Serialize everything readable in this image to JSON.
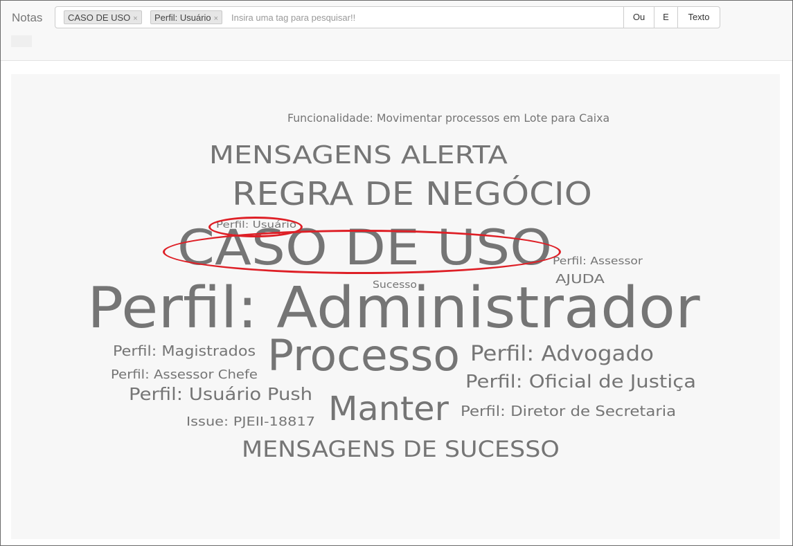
{
  "header": {
    "title": "Notas",
    "search": {
      "tags": [
        {
          "label": "CASO DE USO",
          "remove": "×"
        },
        {
          "label": "Perfil: Usuário",
          "remove": "×"
        }
      ],
      "placeholder": "Insira uma tag para pesquisar!!",
      "value": ""
    },
    "buttons": {
      "or": "Ou",
      "and": "E",
      "text": "Texto"
    }
  },
  "tag_cloud": {
    "words": [
      "Funcionalidade: Movimentar processos em Lote para Caixa",
      "MENSAGENS ALERTA",
      "REGRA DE NEGÓCIO",
      "Perfil: Usuário",
      "CASO DE USO",
      "Perfil: Assessor",
      "AJUDA",
      "Sucesso",
      "Perfil: Administrador",
      "Perfil: Magistrados",
      "Processo",
      "Perfil: Advogado",
      "Perfil: Assessor Chefe",
      "Perfil: Oficial de Justiça",
      "Perfil: Usuário Push",
      "Manter",
      "Perfil: Diretor de Secretaria",
      "Issue: PJEII-18817",
      "MENSAGENS DE SUCESSO"
    ],
    "highlighted": [
      "Perfil: Usuário",
      "CASO DE USO"
    ]
  },
  "colors": {
    "word": "#757575",
    "highlight_ring": "#de1f26",
    "cloud_bg": "#f7f7f7"
  }
}
